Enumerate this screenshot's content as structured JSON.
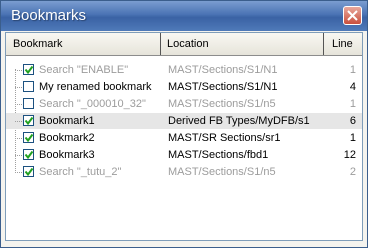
{
  "window": {
    "title": "Bookmarks"
  },
  "columns": {
    "bookmark": "Bookmark",
    "location": "Location",
    "line": "Line"
  },
  "rows": [
    {
      "name": "Search \"ENABLE\"",
      "location": "MAST/Sections/S1/N1",
      "line": "1",
      "checked": true,
      "style": "gray"
    },
    {
      "name": "My renamed bookmark",
      "location": "MAST/Sections/S1/N1",
      "line": "4",
      "checked": false,
      "style": "dark"
    },
    {
      "name": "Search \"_000010_32\"",
      "location": "MAST/Sections/S1/n5",
      "line": "1",
      "checked": false,
      "style": "gray"
    },
    {
      "name": "Bookmark1",
      "location": "Derived FB Types/MyDFB/s1",
      "line": "6",
      "checked": true,
      "style": "dark",
      "selected": true
    },
    {
      "name": "Bookmark2",
      "location": "MAST/SR Sections/sr1",
      "line": "1",
      "checked": true,
      "style": "dark"
    },
    {
      "name": "Bookmark3",
      "location": "MAST/Sections/fbd1",
      "line": "12",
      "checked": true,
      "style": "dark"
    },
    {
      "name": "Search \"_tutu_2\"",
      "location": "MAST/Sections/S1/n5",
      "line": "2",
      "checked": true,
      "style": "gray"
    }
  ]
}
